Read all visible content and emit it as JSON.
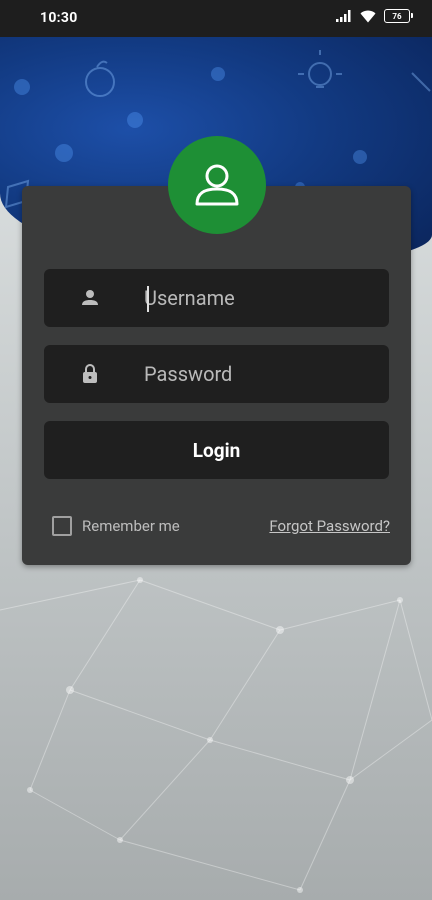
{
  "status_bar": {
    "time": "10:30",
    "battery_level": "76",
    "icons": [
      "signal-icon",
      "wifi-icon",
      "battery-icon"
    ]
  },
  "login": {
    "avatar_icon": "user-icon",
    "username_placeholder": "Username",
    "username_value": "",
    "password_placeholder": "Password",
    "password_value": "",
    "login_button": "Login",
    "remember_me_label": "Remember me",
    "remember_me_checked": false,
    "forgot_password_link": "Forgot Password?"
  },
  "colors": {
    "header_blue": "#123a82",
    "avatar_green": "#1e8f35",
    "card_background": "#3a3b3b",
    "field_background": "#1f1f1f"
  }
}
